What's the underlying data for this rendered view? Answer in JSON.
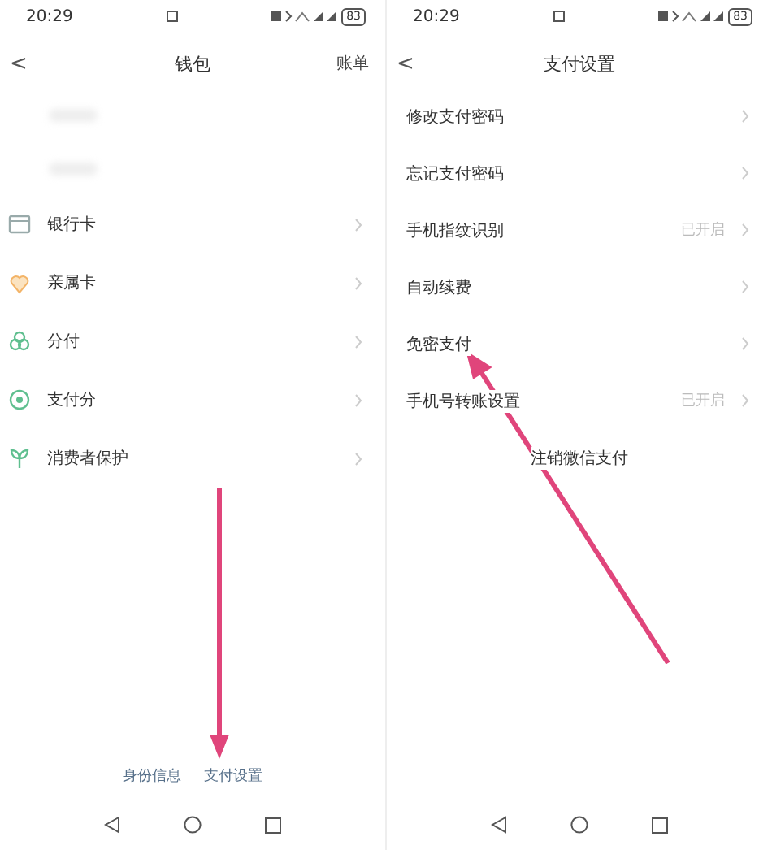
{
  "screens": [
    {
      "status_bar": {
        "time": "20:29",
        "battery": "83"
      },
      "title": "钱包",
      "back": "<",
      "action": "账单",
      "items": [
        {
          "label": "银行卡"
        },
        {
          "label": "亲属卡"
        },
        {
          "label": "分付"
        },
        {
          "label": "支付分"
        },
        {
          "label": "消费者保护"
        }
      ],
      "footer_links": [
        "身份信息",
        "支付设置"
      ]
    },
    {
      "status_bar": {
        "time": "20:29",
        "battery": "83"
      },
      "title": "支付设置",
      "back": "<",
      "items": [
        {
          "label": "修改支付密码"
        },
        {
          "label": "忘记支付密码"
        },
        {
          "label": "手机指纹识别",
          "value": "已开启"
        },
        {
          "label": "自动续费"
        },
        {
          "label": "免密支付"
        },
        {
          "label": "手机号转账设置",
          "value": "已开启"
        }
      ],
      "center_action": "注销微信支付"
    }
  ]
}
